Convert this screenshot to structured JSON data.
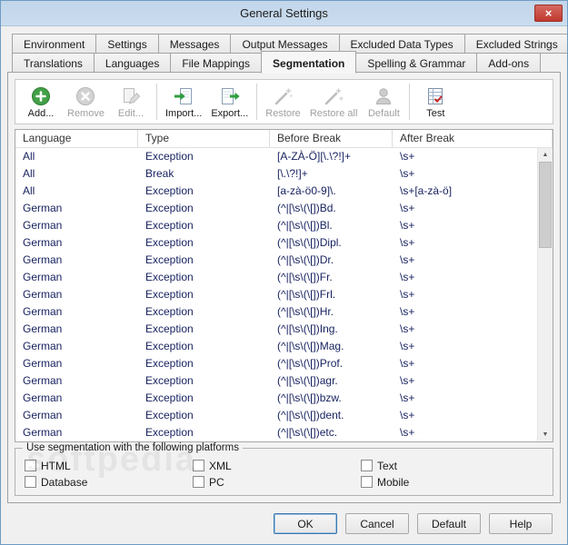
{
  "window": {
    "title": "General Settings",
    "close_glyph": "×"
  },
  "tabs": {
    "row1": [
      {
        "label": "Environment"
      },
      {
        "label": "Settings"
      },
      {
        "label": "Messages"
      },
      {
        "label": "Output Messages"
      },
      {
        "label": "Excluded Data Types"
      },
      {
        "label": "Excluded Strings"
      }
    ],
    "row2": [
      {
        "label": "Translations"
      },
      {
        "label": "Languages"
      },
      {
        "label": "File Mappings"
      },
      {
        "label": "Segmentation",
        "active": true
      },
      {
        "label": "Spelling & Grammar"
      },
      {
        "label": "Add-ons"
      }
    ]
  },
  "toolbar": {
    "items": [
      {
        "label": "Add...",
        "icon": "add-icon",
        "enabled": true
      },
      {
        "label": "Remove",
        "icon": "remove-icon",
        "enabled": false
      },
      {
        "label": "Edit...",
        "icon": "edit-icon",
        "enabled": false
      },
      {
        "label": "Import...",
        "icon": "import-icon",
        "enabled": true
      },
      {
        "label": "Export...",
        "icon": "export-icon",
        "enabled": true
      },
      {
        "label": "Restore",
        "icon": "restore-icon",
        "enabled": false
      },
      {
        "label": "Restore all",
        "icon": "restore-all-icon",
        "enabled": false
      },
      {
        "label": "Default",
        "icon": "default-person-icon",
        "enabled": false
      },
      {
        "label": "Test",
        "icon": "test-icon",
        "enabled": true
      }
    ]
  },
  "table": {
    "columns": [
      "Language",
      "Type",
      "Before Break",
      "After Break"
    ],
    "rows": [
      {
        "language": "All",
        "type": "Exception",
        "before": "[A-ZÀ-Ö][\\.\\?!]+",
        "after": "\\s+"
      },
      {
        "language": "All",
        "type": "Break",
        "before": "[\\.\\?!]+",
        "after": "\\s+"
      },
      {
        "language": "All",
        "type": "Exception",
        "before": "[a-zà-ö0-9]\\.",
        "after": "\\s+[a-zà-ö]"
      },
      {
        "language": "German",
        "type": "Exception",
        "before": "(^|[\\s\\(\\[])Bd.",
        "after": "\\s+"
      },
      {
        "language": "German",
        "type": "Exception",
        "before": "(^|[\\s\\(\\[])Bl.",
        "after": "\\s+"
      },
      {
        "language": "German",
        "type": "Exception",
        "before": "(^|[\\s\\(\\[])Dipl.",
        "after": "\\s+"
      },
      {
        "language": "German",
        "type": "Exception",
        "before": "(^|[\\s\\(\\[])Dr.",
        "after": "\\s+"
      },
      {
        "language": "German",
        "type": "Exception",
        "before": "(^|[\\s\\(\\[])Fr.",
        "after": "\\s+"
      },
      {
        "language": "German",
        "type": "Exception",
        "before": "(^|[\\s\\(\\[])Frl.",
        "after": "\\s+"
      },
      {
        "language": "German",
        "type": "Exception",
        "before": "(^|[\\s\\(\\[])Hr.",
        "after": "\\s+"
      },
      {
        "language": "German",
        "type": "Exception",
        "before": "(^|[\\s\\(\\[])Ing.",
        "after": "\\s+"
      },
      {
        "language": "German",
        "type": "Exception",
        "before": "(^|[\\s\\(\\[])Mag.",
        "after": "\\s+"
      },
      {
        "language": "German",
        "type": "Exception",
        "before": "(^|[\\s\\(\\[])Prof.",
        "after": "\\s+"
      },
      {
        "language": "German",
        "type": "Exception",
        "before": "(^|[\\s\\(\\[])agr.",
        "after": "\\s+"
      },
      {
        "language": "German",
        "type": "Exception",
        "before": "(^|[\\s\\(\\[])bzw.",
        "after": "\\s+"
      },
      {
        "language": "German",
        "type": "Exception",
        "before": "(^|[\\s\\(\\[])dent.",
        "after": "\\s+"
      },
      {
        "language": "German",
        "type": "Exception",
        "before": "(^|[\\s\\(\\[])etc.",
        "after": "\\s+"
      }
    ]
  },
  "platforms": {
    "legend": "Use segmentation with the following platforms",
    "items": [
      {
        "label": "HTML",
        "checked": false
      },
      {
        "label": "XML",
        "checked": false
      },
      {
        "label": "Text",
        "checked": false
      },
      {
        "label": "Database",
        "checked": false
      },
      {
        "label": "PC",
        "checked": false
      },
      {
        "label": "Mobile",
        "checked": false
      }
    ]
  },
  "footer": {
    "buttons": [
      {
        "label": "OK"
      },
      {
        "label": "Cancel"
      },
      {
        "label": "Default"
      },
      {
        "label": "Help"
      }
    ]
  },
  "watermark": "softpedia"
}
